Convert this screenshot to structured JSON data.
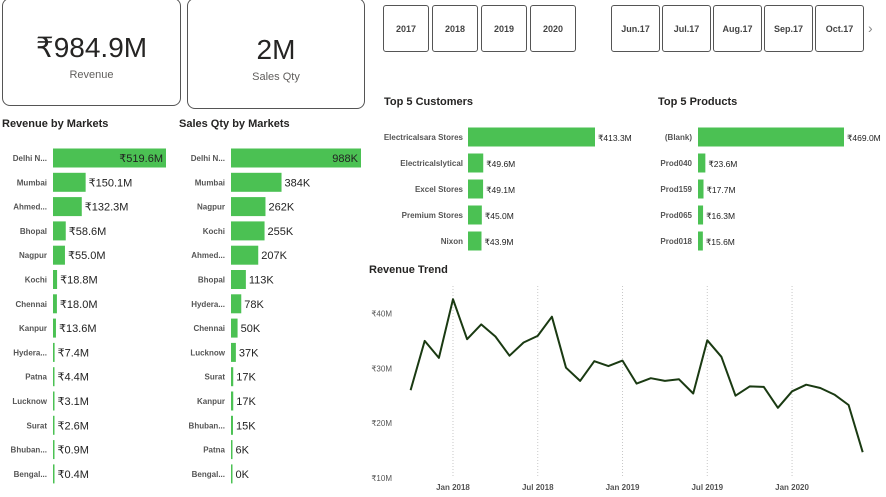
{
  "cards": {
    "revenue": {
      "value": "₹984.9M",
      "label": "Revenue"
    },
    "sales_qty": {
      "value": "2M",
      "label": "Sales Qty"
    }
  },
  "year_slicer": [
    "2017",
    "2018",
    "2019",
    "2020"
  ],
  "month_slicer": [
    "Jun.17",
    "Jul.17",
    "Aug.17",
    "Sep.17",
    "Oct.17"
  ],
  "icons": {
    "next": "chevron-right-icon"
  },
  "colors": {
    "bar": "#4bc153",
    "line": "#1a3a12",
    "border": "#555555"
  },
  "chart_data": [
    {
      "id": "revenue_by_markets",
      "type": "bar",
      "orientation": "horizontal",
      "title": "Revenue by Markets",
      "categories": [
        "Delhi N...",
        "Mumbai",
        "Ahmed...",
        "Bhopal",
        "Nagpur",
        "Kochi",
        "Chennai",
        "Kanpur",
        "Hydera...",
        "Patna",
        "Lucknow",
        "Surat",
        "Bhuban...",
        "Bengal..."
      ],
      "values": [
        519.6,
        150.1,
        132.3,
        58.6,
        55.0,
        18.8,
        18.0,
        13.6,
        7.4,
        4.4,
        3.1,
        2.6,
        0.9,
        0.4
      ],
      "labels": [
        "₹519.6M",
        "₹150.1M",
        "₹132.3M",
        "₹58.6M",
        "₹55.0M",
        "₹18.8M",
        "₹18.0M",
        "₹13.6M",
        "₹7.4M",
        "₹4.4M",
        "₹3.1M",
        "₹2.6M",
        "₹0.9M",
        "₹0.4M"
      ]
    },
    {
      "id": "sales_qty_by_markets",
      "type": "bar",
      "orientation": "horizontal",
      "title": "Sales Qty by Markets",
      "categories": [
        "Delhi N...",
        "Mumbai",
        "Nagpur",
        "Kochi",
        "Ahmed...",
        "Bhopal",
        "Hydera...",
        "Chennai",
        "Lucknow",
        "Surat",
        "Kanpur",
        "Bhuban...",
        "Patna",
        "Bengal..."
      ],
      "values": [
        988,
        384,
        262,
        255,
        207,
        113,
        78,
        50,
        37,
        17,
        17,
        15,
        6,
        0
      ],
      "labels": [
        "988K",
        "384K",
        "262K",
        "255K",
        "207K",
        "113K",
        "78K",
        "50K",
        "37K",
        "17K",
        "17K",
        "15K",
        "6K",
        "0K"
      ]
    },
    {
      "id": "top5_customers",
      "type": "bar",
      "orientation": "horizontal",
      "title": "Top 5 Customers",
      "categories": [
        "Electricalsara Stores",
        "Electricalslytical",
        "Excel Stores",
        "Premium Stores",
        "Nixon"
      ],
      "values": [
        413.3,
        49.6,
        49.1,
        45.0,
        43.9
      ],
      "labels": [
        "₹413.3M",
        "₹49.6M",
        "₹49.1M",
        "₹45.0M",
        "₹43.9M"
      ]
    },
    {
      "id": "top5_products",
      "type": "bar",
      "orientation": "horizontal",
      "title": "Top 5 Products",
      "categories": [
        "(Blank)",
        "Prod040",
        "Prod159",
        "Prod065",
        "Prod018"
      ],
      "values": [
        469.0,
        23.6,
        17.7,
        16.3,
        15.6
      ],
      "labels": [
        "₹469.0M",
        "₹23.6M",
        "₹17.7M",
        "₹16.3M",
        "₹15.6M"
      ]
    },
    {
      "id": "revenue_trend",
      "type": "line",
      "title": "Revenue Trend",
      "ylim": [
        10,
        45
      ],
      "yticks": [
        10,
        20,
        30,
        40
      ],
      "ytick_labels": [
        "₹10M",
        "₹20M",
        "₹30M",
        "₹40M"
      ],
      "xticks": [
        "2018-01",
        "2018-07",
        "2019-01",
        "2019-07",
        "2020-01"
      ],
      "xtick_labels": [
        "Jan 2018",
        "Jul 2018",
        "Jan 2019",
        "Jul 2019",
        "Jan 2020"
      ],
      "xlim": [
        "2017-10",
        "2020-07"
      ],
      "grid": "vertical-dotted",
      "x": [
        "2017-10",
        "2017-11",
        "2017-12",
        "2018-01",
        "2018-02",
        "2018-03",
        "2018-04",
        "2018-05",
        "2018-06",
        "2018-07",
        "2018-08",
        "2018-09",
        "2018-10",
        "2018-11",
        "2018-12",
        "2019-01",
        "2019-02",
        "2019-03",
        "2019-04",
        "2019-05",
        "2019-06",
        "2019-07",
        "2019-08",
        "2019-09",
        "2019-10",
        "2019-11",
        "2019-12",
        "2020-01",
        "2020-02",
        "2020-03",
        "2020-04",
        "2020-05",
        "2020-06"
      ],
      "values": [
        26.0,
        35.0,
        31.9,
        42.6,
        35.3,
        38.0,
        35.8,
        32.3,
        34.7,
        35.9,
        39.4,
        30.1,
        27.7,
        31.3,
        30.4,
        31.4,
        27.2,
        28.2,
        27.7,
        28.0,
        25.4,
        35.1,
        32.1,
        25.0,
        26.7,
        26.6,
        22.8,
        25.8,
        27.0,
        26.4,
        25.2,
        23.3,
        14.7
      ]
    }
  ]
}
